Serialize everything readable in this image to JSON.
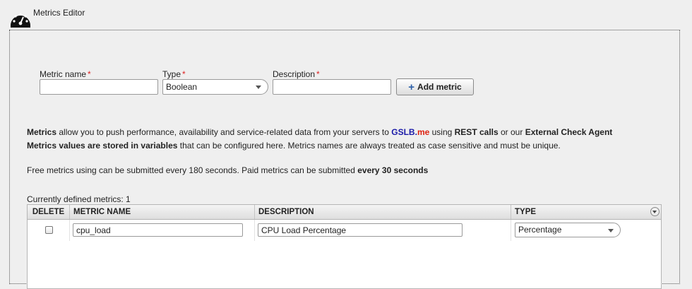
{
  "editor": {
    "title": "Metrics Editor",
    "icon": "speedometer-icon"
  },
  "form": {
    "metric_name_label": "Metric name",
    "type_label": "Type",
    "description_label": "Description",
    "required_mark": "*",
    "metric_name_value": "",
    "type_value": "Boolean",
    "description_value": "",
    "add_button_label": "Add metric",
    "add_button_icon": "plus-icon"
  },
  "info": {
    "line1": {
      "part1": "Metrics",
      "part2": " allow you to push performance, availability and service-related data from your servers to ",
      "brand1": "GSLB.",
      "brand2": "me",
      "part3": " using ",
      "part4": "REST calls",
      "part5": " or our ",
      "part6": "External Check Agent"
    },
    "line2": {
      "part1": "Metrics values are stored in variables",
      "part2": " that can be configured here. Metrics names are always treated as case sensitive and must be unique."
    },
    "line3": {
      "part1": "Free metrics using can be submitted every 180 seconds. Paid metrics can be submitted ",
      "part2": "every 30 seconds"
    }
  },
  "table": {
    "count_label": "Currently defined metrics: 1",
    "headers": [
      "DELETE",
      "METRIC NAME",
      "DESCRIPTION",
      "TYPE"
    ],
    "rows": [
      {
        "delete_checked": false,
        "name": "cpu_load",
        "description": "CPU Load Percentage",
        "type": "Percentage"
      }
    ]
  },
  "colors": {
    "brand_blue": "#1a1aa8",
    "brand_red": "#dd1111",
    "required": "#dd2222",
    "background": "#efefef"
  }
}
